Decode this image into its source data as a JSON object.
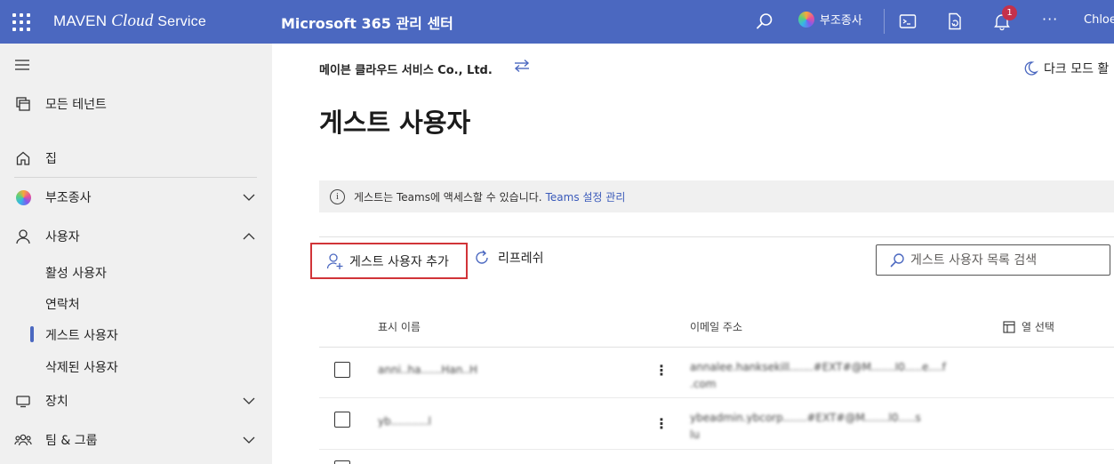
{
  "topbar": {
    "brand_prefix": "MAVEN ",
    "brand_cloud": "Cloud",
    "brand_suffix": " Service",
    "app_title": "Microsoft 365 관리 센터",
    "copilot_label": "부조종사",
    "notification_count": "1",
    "more": "···",
    "user": "Chloe"
  },
  "sidebar": {
    "all_tenants": "모든 테넌트",
    "home": "집",
    "copilot": "부조종사",
    "users": "사용자",
    "users_sub": [
      "활성 사용자",
      "연락처",
      "게스트 사용자",
      "삭제된 사용자"
    ],
    "devices": "장치",
    "teams_groups": "팀 & 그룹"
  },
  "main": {
    "org_name": "메이븐 클라우드 서비스 Co., Ltd.",
    "dark_mode": "다크 모드 활",
    "page_title": "게스트 사용자",
    "info_text": "게스트는 Teams에 액세스할 수 있습니다.",
    "info_link": "Teams 설정 관리",
    "add_guest": "게스트 사용자 추가",
    "refresh": "리프레쉬",
    "search_placeholder": "게스트 사용자 목록 검색",
    "columns": {
      "display_name": "표시 이름",
      "email": "이메일 주소",
      "choose_columns": "열 선택"
    },
    "rows": [
      {
        "name": "anni..ha......Han..H",
        "email_line1": "annalee.hanksekill.......#EXT#@M.......I0.....e....f",
        "email_line2": ".com"
      },
      {
        "name": "yb...........l",
        "email_line1": "ybeadmin.ybcorp.......#EXT#@M.......l0.....s",
        "email_line2": "lu"
      }
    ]
  },
  "colors": {
    "topbar": "#4b68c0",
    "sidebar_bg": "#f0f0f0",
    "highlight_border": "#d13438",
    "link": "#3a5aba",
    "badge": "#c4314b"
  }
}
